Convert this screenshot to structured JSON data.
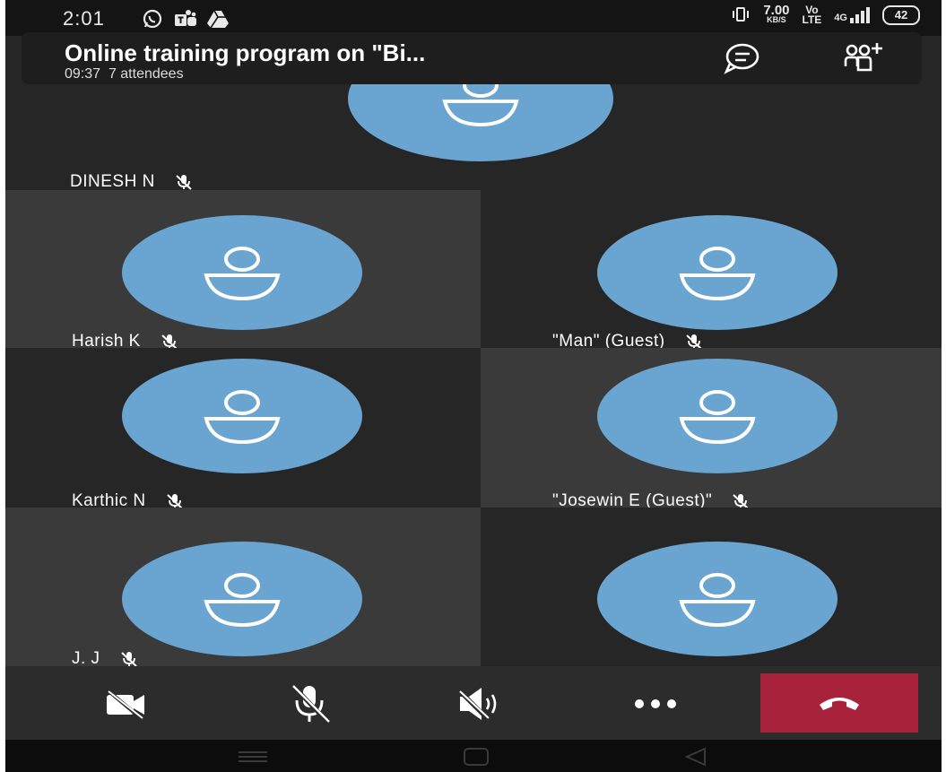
{
  "status_bar": {
    "time": "2:01",
    "speed_value": "7.00",
    "speed_unit": "KB/S",
    "volte_top": "Vo",
    "volte_bottom": "LTE",
    "network": "4G",
    "battery": "42"
  },
  "meeting": {
    "title": "Online training program on \"Bi...",
    "duration": "09:37",
    "attendees": "7 attendees",
    "chat_icon": "chat-bubble-icon",
    "people_icon": "add-people-icon"
  },
  "participants": [
    {
      "name": "DINESH N",
      "muted": true
    },
    {
      "name": "Harish K",
      "muted": true
    },
    {
      "name": "\"Man\" (Guest)",
      "muted": true
    },
    {
      "name": "Karthic N",
      "muted": true
    },
    {
      "name": "\"Josewin E (Guest)\"",
      "muted": true
    },
    {
      "name": "J. J",
      "muted": true
    },
    {
      "name": "",
      "muted": false
    }
  ],
  "controls": {
    "camera": "camera-off-icon",
    "mic": "mic-off-icon",
    "speaker": "speaker-off-icon",
    "more": "more-icon",
    "hangup": "hang-up-icon"
  },
  "colors": {
    "avatar": "#6aa4d1",
    "hangup": "#a7223a",
    "tile_dark": "#262626",
    "tile_light": "#3a3a3a"
  }
}
